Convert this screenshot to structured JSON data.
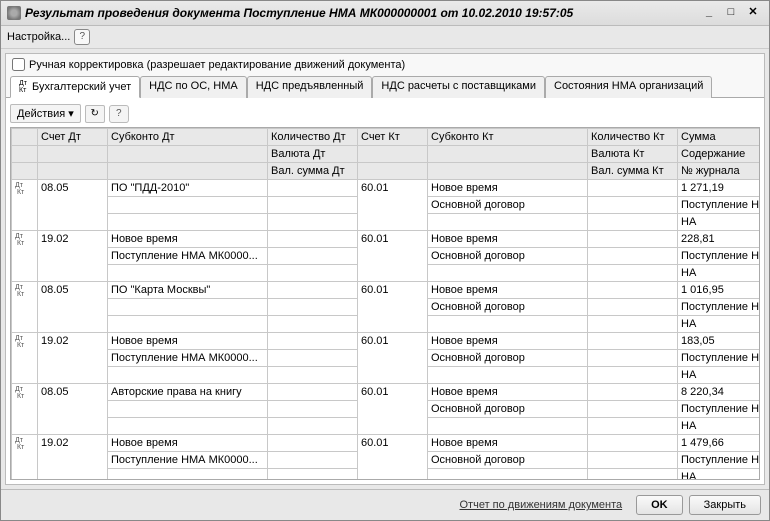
{
  "window": {
    "title": "Результат проведения документа Поступление НМА МК000000001 от 10.02.2010 19:57:05",
    "menubar": {
      "settings": "Настройка..."
    },
    "checkbox_label": "Ручная корректировка (разрешает редактирование движений документа)"
  },
  "tabs": [
    {
      "label": "Бухгалтерский учет",
      "prefix_dtkt": true
    },
    {
      "label": "НДС по ОС, НМА"
    },
    {
      "label": "НДС предъявленный"
    },
    {
      "label": "НДС расчеты с поставщиками"
    },
    {
      "label": "Состояния НМА организаций"
    }
  ],
  "toolbar": {
    "actions": "Действия"
  },
  "grid": {
    "headers": {
      "r1": [
        "",
        "Счет Дт",
        "Субконто Дт",
        "Количество Дт",
        "Счет Кт",
        "Субконто Кт",
        "Количество Кт",
        "Сумма"
      ],
      "r2": [
        "",
        "",
        "",
        "Валюта Дт",
        "",
        "",
        "Валюта Кт",
        "Содержание"
      ],
      "r3": [
        "",
        "",
        "",
        "Вал. сумма Дт",
        "",
        "",
        "Вал. сумма Кт",
        "№ журнала"
      ]
    },
    "rows": [
      {
        "acct_dt": "08.05",
        "sub_dt1": "ПО \"ПДД-2010\"",
        "sub_dt2": "",
        "acct_kt": "60.01",
        "sub_kt1": "Новое время",
        "sub_kt2": "Основной договор",
        "sum": "1 271,19",
        "content": "Поступление НМА по ...",
        "journal": "НА"
      },
      {
        "acct_dt": "19.02",
        "sub_dt1": "Новое время",
        "sub_dt2": "Поступление НМА МК0000...",
        "acct_kt": "60.01",
        "sub_kt1": "Новое время",
        "sub_kt2": "Основной договор",
        "sum": "228,81",
        "content": "Поступление НМА по ...",
        "journal": "НА"
      },
      {
        "acct_dt": "08.05",
        "sub_dt1": "ПО \"Карта Москвы\"",
        "sub_dt2": "",
        "acct_kt": "60.01",
        "sub_kt1": "Новое время",
        "sub_kt2": "Основной договор",
        "sum": "1 016,95",
        "content": "Поступление НМА по ...",
        "journal": "НА"
      },
      {
        "acct_dt": "19.02",
        "sub_dt1": "Новое время",
        "sub_dt2": "Поступление НМА МК0000...",
        "acct_kt": "60.01",
        "sub_kt1": "Новое время",
        "sub_kt2": "Основной договор",
        "sum": "183,05",
        "content": "Поступление НМА по ...",
        "journal": "НА"
      },
      {
        "acct_dt": "08.05",
        "sub_dt1": "Авторские права на книгу",
        "sub_dt2": "",
        "acct_kt": "60.01",
        "sub_kt1": "Новое время",
        "sub_kt2": "Основной договор",
        "sum": "8 220,34",
        "content": "Поступление НМА по ...",
        "journal": "НА"
      },
      {
        "acct_dt": "19.02",
        "sub_dt1": "Новое время",
        "sub_dt2": "Поступление НМА МК0000...",
        "acct_kt": "60.01",
        "sub_kt1": "Новое время",
        "sub_kt2": "Основной договор",
        "sum": "1 479,66",
        "content": "Поступление НМА по ...",
        "journal": "НА"
      }
    ]
  },
  "footer": {
    "report_link": "Отчет по движениям документа",
    "ok": "OK",
    "close": "Закрыть"
  }
}
